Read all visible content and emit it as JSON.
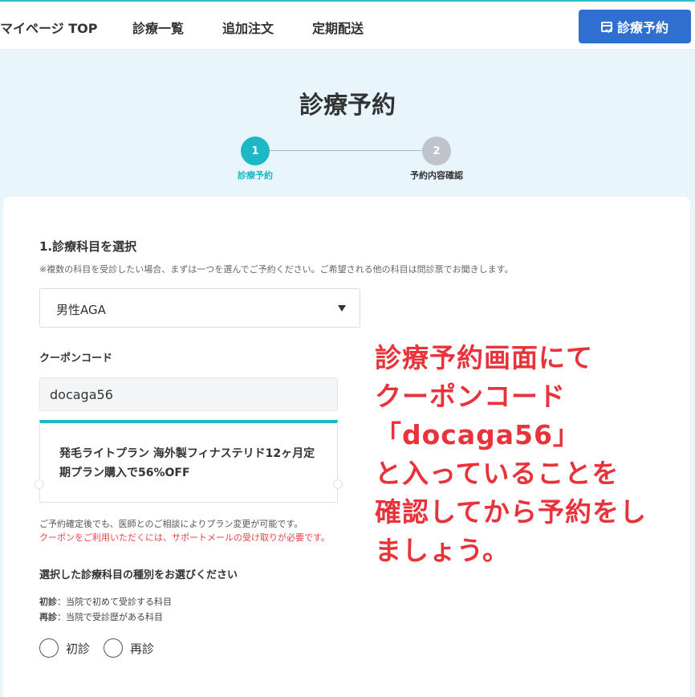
{
  "nav": {
    "items": [
      {
        "label": "マイページ TOP"
      },
      {
        "label": "診療一覧"
      },
      {
        "label": "追加注文"
      },
      {
        "label": "定期配送"
      }
    ],
    "cta_label": "診療予約"
  },
  "page": {
    "title": "診療予約",
    "steps": [
      {
        "number": "1",
        "label": "診療予約",
        "state": "active"
      },
      {
        "number": "2",
        "label": "予約内容確認",
        "state": "inactive"
      }
    ]
  },
  "form": {
    "section_title": "1.診療科目を選択",
    "section_note": "※複数の科目を受診したい場合、まずは一つを選んでご予約ください。ご希望される他の科目は問診票でお聞きします。",
    "subject_value": "男性AGA",
    "coupon_label": "クーポンコード",
    "coupon_value": "docaga56",
    "coupon_plan": "発毛ライトプラン 海外製フィナステリド12ヶ月定期プラン購入で56%OFF",
    "hint_plan_change": "ご予約確定後でも、医師とのご相談によりプラン変更が可能です。",
    "hint_coupon": "クーポンをご利用いただくには、サポートメールの受け取りが必要です。",
    "type_title": "選択した診療科目の種別をお選びください",
    "definitions": [
      {
        "term": "初診",
        "desc": "：当院で初めて受診する科目"
      },
      {
        "term": "再診",
        "desc": "：当院で受診歴がある科目"
      }
    ],
    "radio_options": [
      {
        "label": "初診"
      },
      {
        "label": "再診"
      }
    ]
  },
  "annotation": {
    "lines": [
      "診療予約画面にて",
      "クーポンコード",
      "「docaga56」",
      "と入っていることを",
      "確認してから予約をし",
      "ましょう。"
    ]
  },
  "colors": {
    "accent_teal": "#1cb8c6",
    "cta_blue": "#2f6fcf",
    "annotation_red": "#e8333b",
    "warning_red": "#e8424a",
    "page_bg": "#e8f5fb"
  },
  "icons": {
    "cta": "calendar-check-icon",
    "select": "caret-down-icon"
  }
}
